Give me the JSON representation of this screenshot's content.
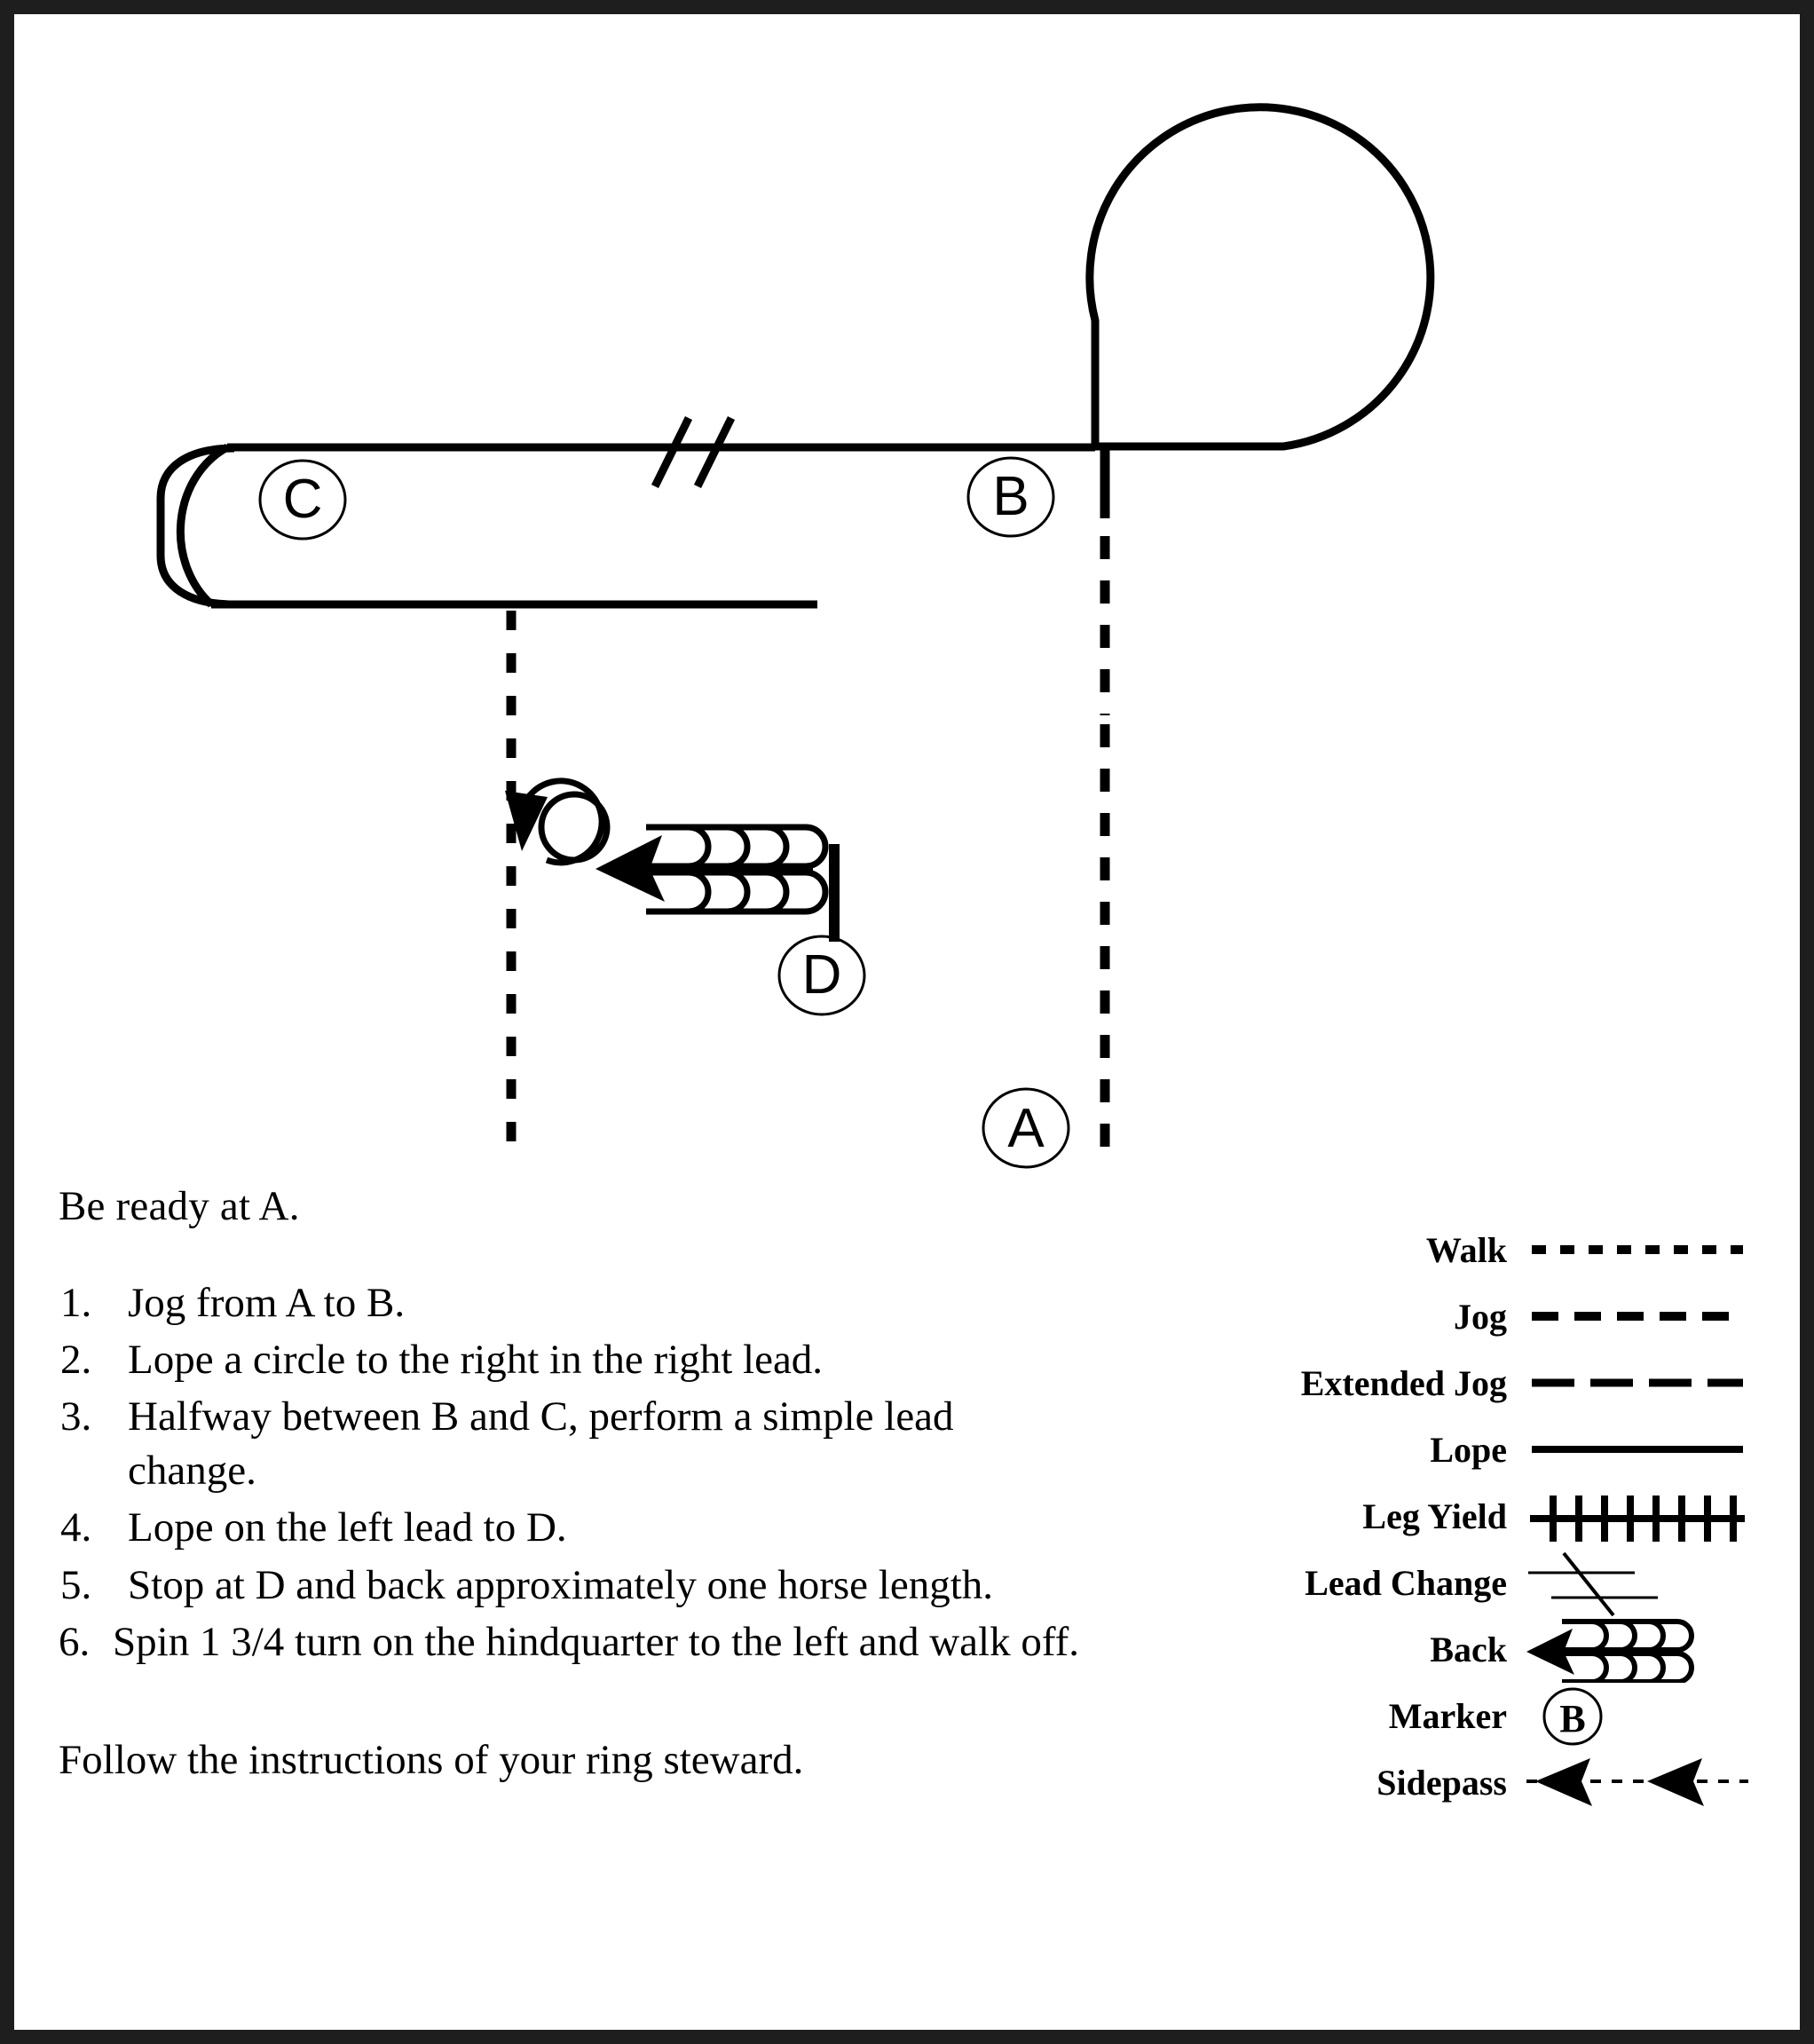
{
  "document": {
    "type": "horsemanship-pattern-sheet",
    "border_color": "#1e1e1e",
    "ink_color": "#000000",
    "background_color": "#ffffff"
  },
  "diagram": {
    "markers": [
      {
        "id": "A",
        "label": "A"
      },
      {
        "id": "B",
        "label": "B"
      },
      {
        "id": "C",
        "label": "C"
      },
      {
        "id": "D",
        "label": "D"
      }
    ],
    "elements": {
      "lope_circle": "large loop to the right at B",
      "lead_change_slashes": "two slashes halfway between B and C",
      "stop_bar": "vertical stop bar at D",
      "back_symbol": "four-hook double-row back arrow pointing left",
      "spin_symbol": "circular arrow spin to the left",
      "walk_off": "dashed walk line"
    }
  },
  "instructions": {
    "lead_in": "Be ready at A.",
    "steps": [
      {
        "num": "1.",
        "text": "Jog from A to B."
      },
      {
        "num": "2.",
        "text": "Lope a circle to the right in the right lead."
      },
      {
        "num": "3.",
        "text": "Halfway between B and C, perform a simple lead change."
      },
      {
        "num": "4.",
        "text": "Lope on the left lead to D."
      },
      {
        "num": "5.",
        "text": "Stop at D and back approximately one horse length."
      },
      {
        "num": "6.",
        "text": "Spin 1 3/4 turn on the hindquarter to the left and walk off."
      }
    ],
    "closing": "Follow the instructions of  your ring steward."
  },
  "legend": {
    "rows": [
      {
        "label": "Walk",
        "symbol": "walk-dotted-line"
      },
      {
        "label": "Jog",
        "symbol": "jog-dashed-line"
      },
      {
        "label": "Extended Jog",
        "symbol": "extended-jog-long-dash-line"
      },
      {
        "label": "Lope",
        "symbol": "lope-solid-line"
      },
      {
        "label": "Leg Yield",
        "symbol": "leg-yield-hatched-line"
      },
      {
        "label": "Lead Change",
        "symbol": "lead-change-slash"
      },
      {
        "label": "Back",
        "symbol": "back-arrow-hooks"
      },
      {
        "label": "Marker",
        "symbol": "marker-circle"
      },
      {
        "label": "Sidepass",
        "symbol": "sidepass-double-arrow"
      }
    ],
    "marker_example_label": "B"
  }
}
